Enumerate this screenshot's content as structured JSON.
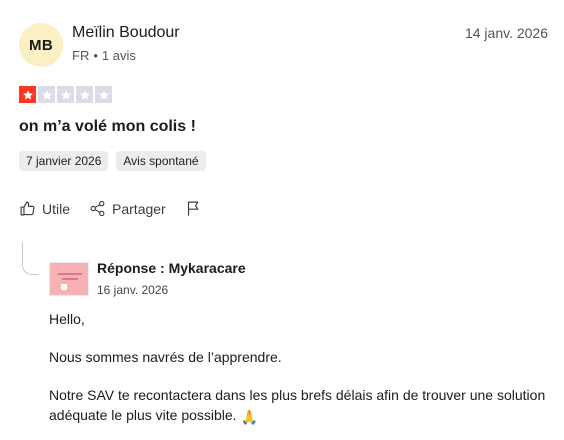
{
  "review": {
    "avatar_initials": "MB",
    "author": "Meïlin Boudour",
    "country": "FR",
    "review_count": "1 avis",
    "date": "14 janv. 2026",
    "rating": 1,
    "rating_max": 5,
    "title": "on m’a volé mon colis !",
    "tags": [
      "7 janvier 2026",
      "Avis spontané"
    ],
    "colors": {
      "star_on": "#ff3722",
      "star_off": "#dcdce6",
      "avatar_bg": "#fbf0c4"
    }
  },
  "actions": {
    "useful_label": "Utile",
    "share_label": "Partager",
    "icons": {
      "useful": "thumbs-up-icon",
      "share": "share-icon",
      "report": "flag-icon"
    }
  },
  "reply": {
    "title": "Réponse : Mykaracare",
    "date": "16 janv. 2026",
    "paragraphs": [
      "Hello,",
      "Nous sommes navrés de l’apprendre.",
      "Notre SAV te recontactera dans les plus brefs délais afin de trouver une solution adéquate le plus vite possible."
    ],
    "emoji": "🙏"
  }
}
